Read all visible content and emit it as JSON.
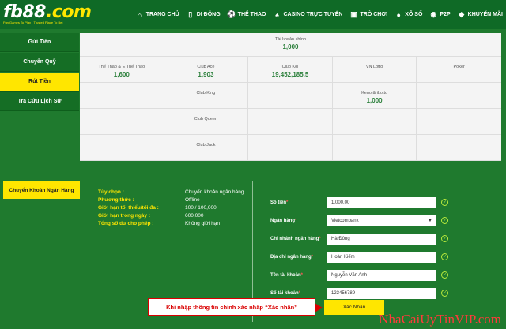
{
  "header": {
    "logo": "fb88",
    "logo_suffix": ".com",
    "tagline": "Fun Games To Play · Trusted Place To Bet",
    "nav": [
      {
        "label": "TRANG CHỦ",
        "icon": "home-icon",
        "glyph": "⌂"
      },
      {
        "label": "DI ĐỘNG",
        "icon": "mobile-icon",
        "glyph": "▯"
      },
      {
        "label": "THỂ THAO",
        "icon": "soccer-ball-icon",
        "glyph": "⚽"
      },
      {
        "label": "CASINO TRỰC TUYẾN",
        "icon": "cards-icon",
        "glyph": "♠"
      },
      {
        "label": "TRÒ CHƠI",
        "icon": "slot-machine-icon",
        "glyph": "▣"
      },
      {
        "label": "XỔ SỐ",
        "icon": "lottery-balls-icon",
        "glyph": "●"
      },
      {
        "label": "P2P",
        "icon": "p2p-icon",
        "glyph": "◉"
      },
      {
        "label": "KHUYẾN MÃI",
        "icon": "gift-icon",
        "glyph": "◆"
      }
    ]
  },
  "sidebar": {
    "items": [
      {
        "label": "Gửi Tiền"
      },
      {
        "label": "Chuyển Quỹ"
      },
      {
        "label": "Rút Tiền"
      },
      {
        "label": "Tra Cứu Lịch Sử"
      }
    ]
  },
  "balances": {
    "main": {
      "label": "Tài khoản chính",
      "value": "1,000"
    },
    "cells": [
      {
        "label": "Thể Thao & E Thể Thao",
        "value": "1,600"
      },
      {
        "label": "Club Ace",
        "value": "1,903"
      },
      {
        "label": "Club Koi",
        "value": "19,452,185.5"
      },
      {
        "label": "VN Lotto",
        "value": ""
      },
      {
        "label": "Poker",
        "value": ""
      },
      {
        "label": "",
        "value": ""
      },
      {
        "label": "Club King",
        "value": ""
      },
      {
        "label": "",
        "value": ""
      },
      {
        "label": "Keno & iLotto",
        "value": "1,000"
      },
      {
        "label": "",
        "value": ""
      },
      {
        "label": "",
        "value": ""
      },
      {
        "label": "Club Queen",
        "value": ""
      },
      {
        "label": "",
        "value": ""
      },
      {
        "label": "",
        "value": ""
      },
      {
        "label": "",
        "value": ""
      },
      {
        "label": "",
        "value": ""
      },
      {
        "label": "Club Jack",
        "value": ""
      },
      {
        "label": "",
        "value": ""
      },
      {
        "label": "",
        "value": ""
      },
      {
        "label": "",
        "value": ""
      }
    ]
  },
  "method": {
    "button": "Chuyển Khoản Ngân Hàng",
    "info": [
      {
        "key": "Tùy chọn :",
        "value": "Chuyển khoản ngân hàng"
      },
      {
        "key": "Phương thức :",
        "value": "Offline"
      },
      {
        "key": "Giới hạn tối thiểu/tối đa :",
        "value": "100 / 100,000"
      },
      {
        "key": "Giới hạn trong ngày :",
        "value": "600,000"
      },
      {
        "key": "Tổng số dư cho phép :",
        "value": "Không giới hạn"
      }
    ]
  },
  "form": {
    "fields": [
      {
        "label": "Số tiền",
        "value": "1,000.00",
        "name": "amount-field"
      },
      {
        "label": "Ngân hàng",
        "value": "Vietcombank",
        "name": "bank-select"
      },
      {
        "label": "Chi nhánh ngân hàng",
        "value": "Hà Đông",
        "name": "bank-branch-field"
      },
      {
        "label": "Địa chỉ ngân hàng",
        "value": "Hoàn Kiếm",
        "name": "bank-address-field"
      },
      {
        "label": "Tên tài khoản",
        "value": "Nguyễn Văn Anh",
        "name": "account-name-field"
      },
      {
        "label": "Số tài khoản",
        "value": "123456789",
        "name": "account-number-field"
      }
    ],
    "required_mark": "*",
    "confirm": "Xác Nhận"
  },
  "callout": "Khi nhập thông tin chính xác nhấp “Xác nhận”",
  "watermark": "NhaCaiUyTinVIP.com",
  "colors": {
    "brand_green": "#1f7a2e",
    "accent_yellow": "#ffe600",
    "callout_red": "#d90000"
  }
}
